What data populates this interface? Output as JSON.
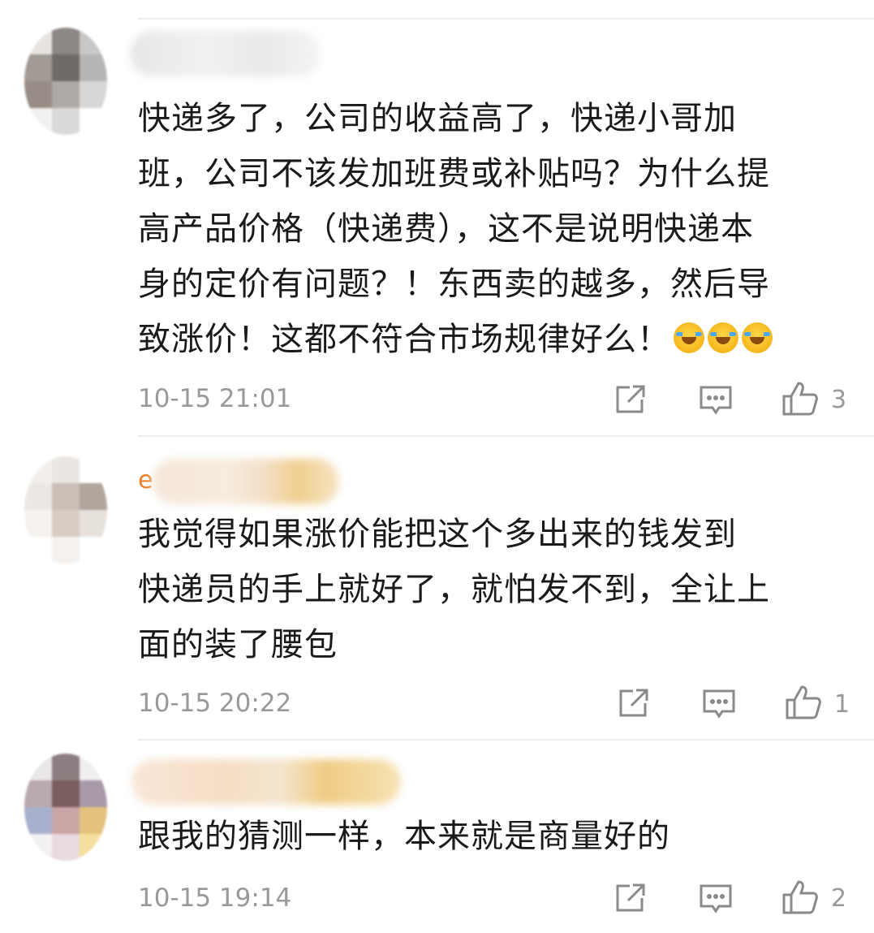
{
  "comments": [
    {
      "text_lines": [
        "快递多了，公司的收益高了，快递小哥加",
        "班，公司不该发加班费或补贴吗？为什么提",
        "高产品价格（快递费），这不是说明快递本",
        "身的定价有问题？！东西卖的越多，然后导",
        "致涨价！这都不符合市场规律好么！"
      ],
      "emoji": "laugh-cry-emoji",
      "timestamp": "10-15 21:01",
      "likes": "3",
      "username_visible": ""
    },
    {
      "text_lines": [
        "我觉得如果涨价能把这个多出来的钱发到",
        "快递员的手上就好了，就怕发不到，全让上",
        "面的装了腰包"
      ],
      "timestamp": "10-15 20:22",
      "likes": "1",
      "username_visible": "e"
    },
    {
      "text_lines": [
        "跟我的猜测一样，本来就是商量好的"
      ],
      "timestamp": "10-15 19:14",
      "likes": "2",
      "username_visible": ""
    }
  ],
  "icons": {
    "share": "share-icon",
    "reply": "comment-icon",
    "like": "thumbs-up-icon"
  },
  "colors": {
    "username": "#e9812a",
    "text": "#1a1a1a",
    "meta": "#999999"
  }
}
